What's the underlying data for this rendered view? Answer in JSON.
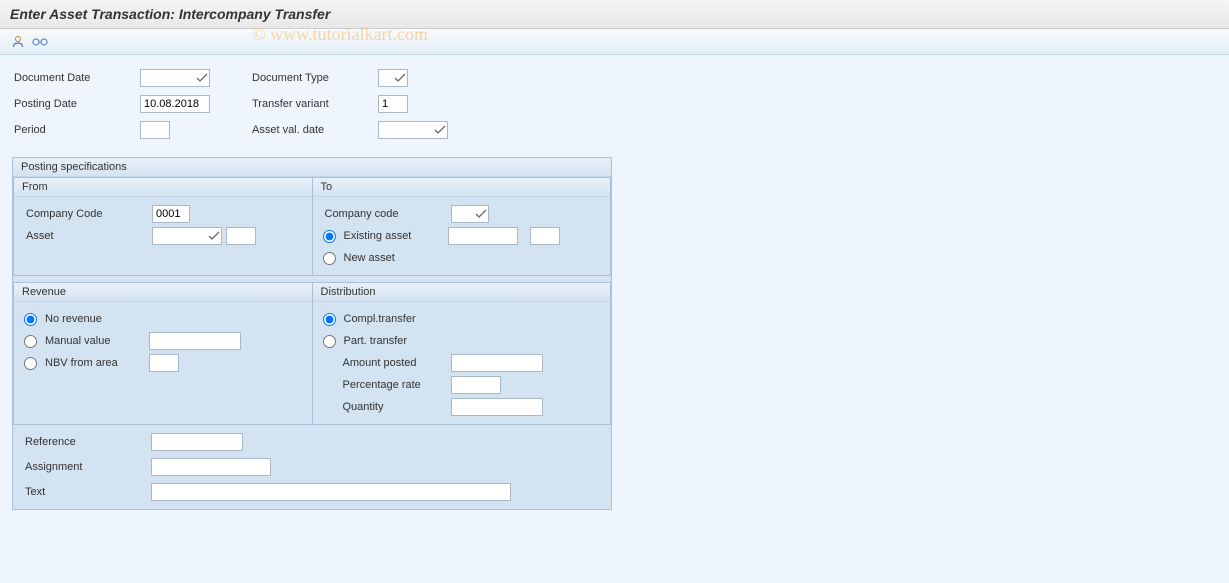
{
  "title": "Enter Asset Transaction: Intercompany Transfer",
  "watermark": "© www.tutorialkart.com",
  "header": {
    "left": {
      "document_date_label": "Document Date",
      "document_date_value": "",
      "posting_date_label": "Posting Date",
      "posting_date_value": "10.08.2018",
      "period_label": "Period",
      "period_value": ""
    },
    "right": {
      "document_type_label": "Document Type",
      "document_type_value": "",
      "transfer_variant_label": "Transfer variant",
      "transfer_variant_value": "1",
      "asset_val_date_label": "Asset val. date",
      "asset_val_date_value": ""
    }
  },
  "posting_spec_title": "Posting specifications",
  "from": {
    "title": "From",
    "company_code_label": "Company Code",
    "company_code_value": "0001",
    "asset_label": "Asset",
    "asset_value": "",
    "asset_sub_value": ""
  },
  "to": {
    "title": "To",
    "company_code_label": "Company code",
    "company_code_value": "",
    "existing_asset_label": "Existing asset",
    "existing_asset_value": "",
    "existing_asset_sub_value": "",
    "new_asset_label": "New asset"
  },
  "revenue": {
    "title": "Revenue",
    "no_revenue_label": "No revenue",
    "manual_value_label": "Manual value",
    "manual_value": "",
    "nbv_from_area_label": "NBV from area",
    "nbv_value": ""
  },
  "distribution": {
    "title": "Distribution",
    "compl_transfer_label": "Compl.transfer",
    "part_transfer_label": "Part. transfer",
    "amount_posted_label": "Amount posted",
    "amount_posted_value": "",
    "percentage_rate_label": "Percentage rate",
    "percentage_rate_value": "",
    "quantity_label": "Quantity",
    "quantity_value": ""
  },
  "footer": {
    "reference_label": "Reference",
    "reference_value": "",
    "assignment_label": "Assignment",
    "assignment_value": "",
    "text_label": "Text",
    "text_value": ""
  }
}
